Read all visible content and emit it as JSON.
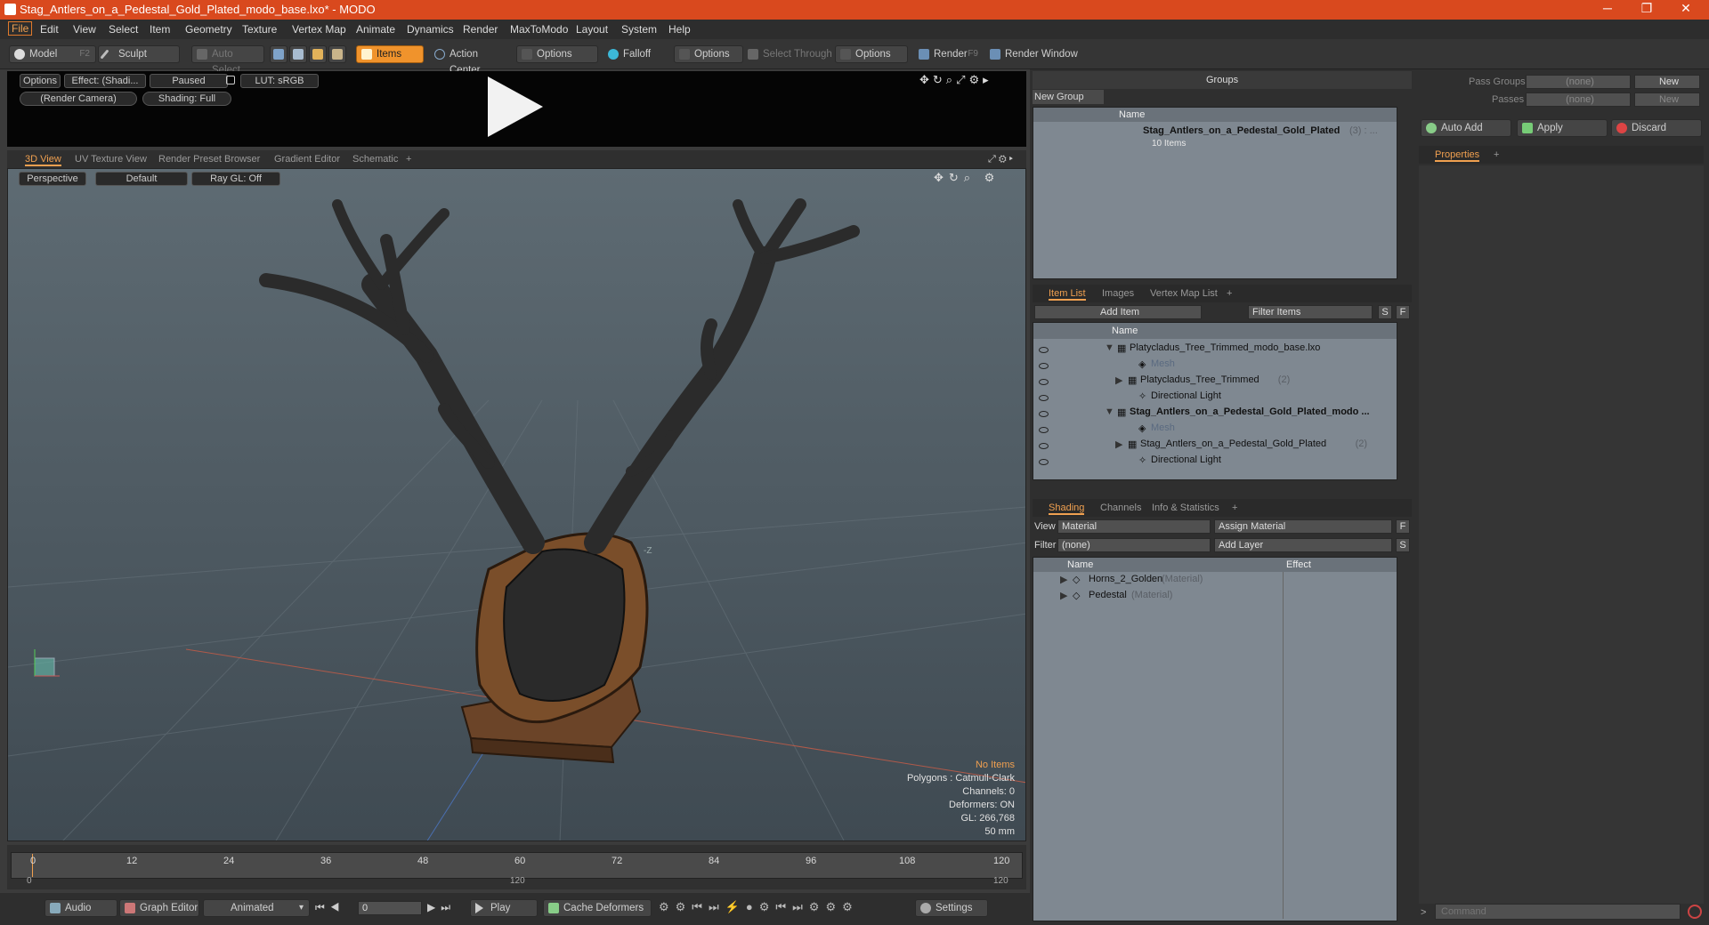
{
  "window": {
    "title": "Stag_Antlers_on_a_Pedestal_Gold_Plated_modo_base.lxo* - MODO"
  },
  "menu": [
    "File",
    "Edit",
    "View",
    "Select",
    "Item",
    "Geometry",
    "Texture",
    "Vertex Map",
    "Animate",
    "Dynamics",
    "Render",
    "MaxToModo",
    "Layout",
    "System",
    "Help"
  ],
  "toolbar": {
    "model": "Model",
    "model_key": "F2",
    "sculpt": "Sculpt",
    "auto_select": "Auto Select",
    "items": "Items",
    "action_center": "Action Center",
    "options1": "Options",
    "falloff": "Falloff",
    "options2": "Options",
    "select_through": "Select Through",
    "options3": "Options",
    "render": "Render",
    "render_key": "F9",
    "render_window": "Render Window"
  },
  "render_preview": {
    "options": "Options",
    "effect": "Effect: (Shadi...",
    "paused": "Paused",
    "lut": "LUT: sRGB",
    "camera": "(Render Camera)",
    "shading": "Shading: Full"
  },
  "view_tabs": [
    "3D View",
    "UV Texture View",
    "Render Preset Browser",
    "Gradient Editor",
    "Schematic",
    "+"
  ],
  "viewport": {
    "projection": "Perspective",
    "style": "Default",
    "raygl": "Ray GL: Off",
    "axis_label": "-Z",
    "info": {
      "selection": "No Items",
      "polygons": "Polygons : Catmull-Clark",
      "channels": "Channels: 0",
      "deformers": "Deformers: ON",
      "gl": "GL: 266,768",
      "focal": "50 mm"
    }
  },
  "timeline": {
    "ticks": [
      "0",
      "12",
      "24",
      "36",
      "48",
      "60",
      "72",
      "84",
      "96",
      "108",
      "120"
    ],
    "start": "0",
    "mid": "120",
    "end": "120"
  },
  "bottombar": {
    "audio": "Audio",
    "graph_editor": "Graph Editor",
    "animated": "Animated",
    "frame": "0",
    "play": "Play",
    "cache_deformers": "Cache Deformers",
    "settings": "Settings"
  },
  "groups": {
    "title": "Groups",
    "new_group": "New Group",
    "col_name": "Name",
    "item_name": "Stag_Antlers_on_a_Pedestal_Gold_Plated",
    "item_count": "(3) : ...",
    "item_sub": "10 Items"
  },
  "passes": {
    "pass_groups_label": "Pass Groups",
    "pass_groups_value": "(none)",
    "new1": "New",
    "passes_label": "Passes",
    "passes_value": "(none)",
    "new2": "New"
  },
  "actions": {
    "auto_add": "Auto Add",
    "apply": "Apply",
    "discard": "Discard"
  },
  "properties": {
    "tab": "Properties",
    "plus": "+"
  },
  "item_list": {
    "tabs": [
      "Item List",
      "Images",
      "Vertex Map List",
      "+"
    ],
    "add_item": "Add Item",
    "filter_items": "Filter Items",
    "s": "S",
    "f": "F",
    "col_name": "Name",
    "rows": [
      {
        "name": "Platycladus_Tree_Trimmed_modo_base.lxo",
        "extra": "",
        "indent": 0,
        "arrow": "▼",
        "kind": "scene",
        "bold": false,
        "gray": false
      },
      {
        "name": "Mesh",
        "extra": "",
        "indent": 2,
        "arrow": "",
        "kind": "mesh",
        "bold": false,
        "gray": true
      },
      {
        "name": "Platycladus_Tree_Trimmed",
        "extra": "(2)",
        "indent": 1,
        "arrow": "▶",
        "kind": "group",
        "bold": false,
        "gray": false
      },
      {
        "name": "Directional Light",
        "extra": "",
        "indent": 2,
        "arrow": "",
        "kind": "light",
        "bold": false,
        "gray": false
      },
      {
        "name": "Stag_Antlers_on_a_Pedestal_Gold_Plated_modo ...",
        "extra": "",
        "indent": 0,
        "arrow": "▼",
        "kind": "scene",
        "bold": true,
        "gray": false
      },
      {
        "name": "Mesh",
        "extra": "",
        "indent": 2,
        "arrow": "",
        "kind": "mesh",
        "bold": false,
        "gray": true
      },
      {
        "name": "Stag_Antlers_on_a_Pedestal_Gold_Plated",
        "extra": "(2)",
        "indent": 1,
        "arrow": "▶",
        "kind": "group",
        "bold": false,
        "gray": false
      },
      {
        "name": "Directional Light",
        "extra": "",
        "indent": 2,
        "arrow": "",
        "kind": "light",
        "bold": false,
        "gray": false
      }
    ]
  },
  "shading": {
    "tabs": [
      "Shading",
      "Channels",
      "Info & Statistics",
      "+"
    ],
    "view_label": "View",
    "view_value": "Material",
    "assign_material": "Assign Material",
    "f": "F",
    "filter_label": "Filter",
    "filter_value": "(none)",
    "add_layer": "Add Layer",
    "s": "S",
    "col_name": "Name",
    "col_effect": "Effect",
    "rows": [
      {
        "name": "Horns_2_Golden",
        "type": "(Material)"
      },
      {
        "name": "Pedestal",
        "type": "(Material)"
      }
    ]
  },
  "command": {
    "placeholder": "Command"
  },
  "colors": {
    "accent": "#f0932c",
    "title": "#d9491e"
  }
}
